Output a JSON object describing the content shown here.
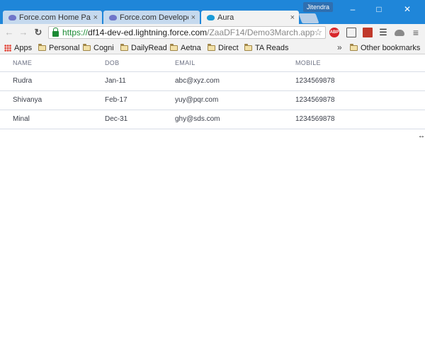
{
  "browser": {
    "tabs": [
      {
        "title": "Force.com Home Pag",
        "active": false
      },
      {
        "title": "Force.com Developer",
        "active": false
      },
      {
        "title": "Aura",
        "active": true
      }
    ],
    "tab_close_glyph": "×",
    "user_name": "Jitendra",
    "window_controls": [
      "minimize",
      "maximize",
      "close"
    ],
    "url": {
      "scheme": "https://",
      "host": "df14-dev-ed.lightning.force.com",
      "path": "/ZaaDF14/Demo3March.app"
    },
    "extensions": [
      "abp-icon",
      "cast-icon",
      "book-icon",
      "stack-icon",
      "cloud-icon",
      "menu-icon"
    ],
    "abp_label": "ABP",
    "bookmarks": [
      {
        "label": "Apps",
        "icon": "apps-icon"
      },
      {
        "label": "Personal",
        "icon": "folder-icon"
      },
      {
        "label": "Cogni",
        "icon": "folder-icon"
      },
      {
        "label": "DailyRead",
        "icon": "folder-icon"
      },
      {
        "label": "Aetna",
        "icon": "folder-icon"
      },
      {
        "label": "Direct",
        "icon": "folder-icon"
      },
      {
        "label": "TA Reads",
        "icon": "folder-icon"
      }
    ],
    "overflow_glyph": "»",
    "other_bookmarks": "Other bookmarks"
  },
  "table": {
    "headers": [
      "Name",
      "DOB",
      "Email",
      "Mobile"
    ],
    "rows": [
      {
        "name": "Rudra",
        "dob": "Jan-11",
        "email": "abc@xyz.com",
        "mobile": "1234569878"
      },
      {
        "name": "Shivanya",
        "dob": "Feb-17",
        "email": "yuy@pqr.com",
        "mobile": "1234569878"
      },
      {
        "name": "Minal",
        "dob": "Dec-31",
        "email": "ghy@sds.com",
        "mobile": "1234569878"
      }
    ]
  },
  "colors": {
    "titlebar": "#1f86d9",
    "header_text": "#6e7385",
    "row_border": "#d8dde6",
    "secure_green": "#1b8a34"
  }
}
